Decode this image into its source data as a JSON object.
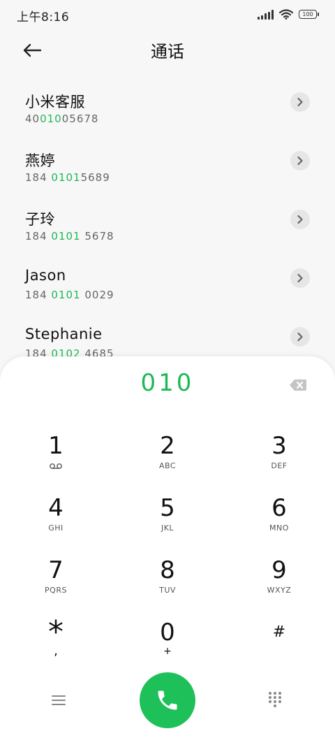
{
  "status": {
    "time": "上午8:16",
    "battery": "100"
  },
  "header": {
    "title": "通话"
  },
  "contacts": [
    {
      "name": "小米客服",
      "number_pre": "40",
      "number_hl": "010",
      "number_post": "05678"
    },
    {
      "name": "燕婷",
      "number_pre": "184 ",
      "number_hl": "0101",
      "number_post": "5689"
    },
    {
      "name": "子玲",
      "number_pre": "184 ",
      "number_hl": "0101",
      "number_post": " 5678"
    },
    {
      "name": "Jason",
      "number_pre": "184 ",
      "number_hl": "0101",
      "number_post": " 0029"
    },
    {
      "name": "Stephanie",
      "number_pre": "184 ",
      "number_hl": "0102",
      "number_post": " 4685"
    }
  ],
  "dialer": {
    "number": "010",
    "keys": [
      {
        "digit": "1",
        "letters": "",
        "voicemail": true
      },
      {
        "digit": "2",
        "letters": "ABC"
      },
      {
        "digit": "3",
        "letters": "DEF"
      },
      {
        "digit": "4",
        "letters": "GHI"
      },
      {
        "digit": "5",
        "letters": "JKL"
      },
      {
        "digit": "6",
        "letters": "MNO"
      },
      {
        "digit": "7",
        "letters": "PQRS"
      },
      {
        "digit": "8",
        "letters": "TUV"
      },
      {
        "digit": "9",
        "letters": "WXYZ"
      },
      {
        "digit": "*",
        "letters": ","
      },
      {
        "digit": "0",
        "letters": "+"
      },
      {
        "digit": "#",
        "letters": ""
      }
    ]
  },
  "icons": {
    "back": "arrow-left-icon",
    "detail": "chevron-right-icon",
    "delete": "backspace-icon",
    "voicemail": "voicemail-icon",
    "menu": "menu-icon",
    "call": "phone-icon",
    "dialpad": "dialpad-icon"
  },
  "colors": {
    "accent": "#1db954",
    "call_button": "#1ec159"
  }
}
